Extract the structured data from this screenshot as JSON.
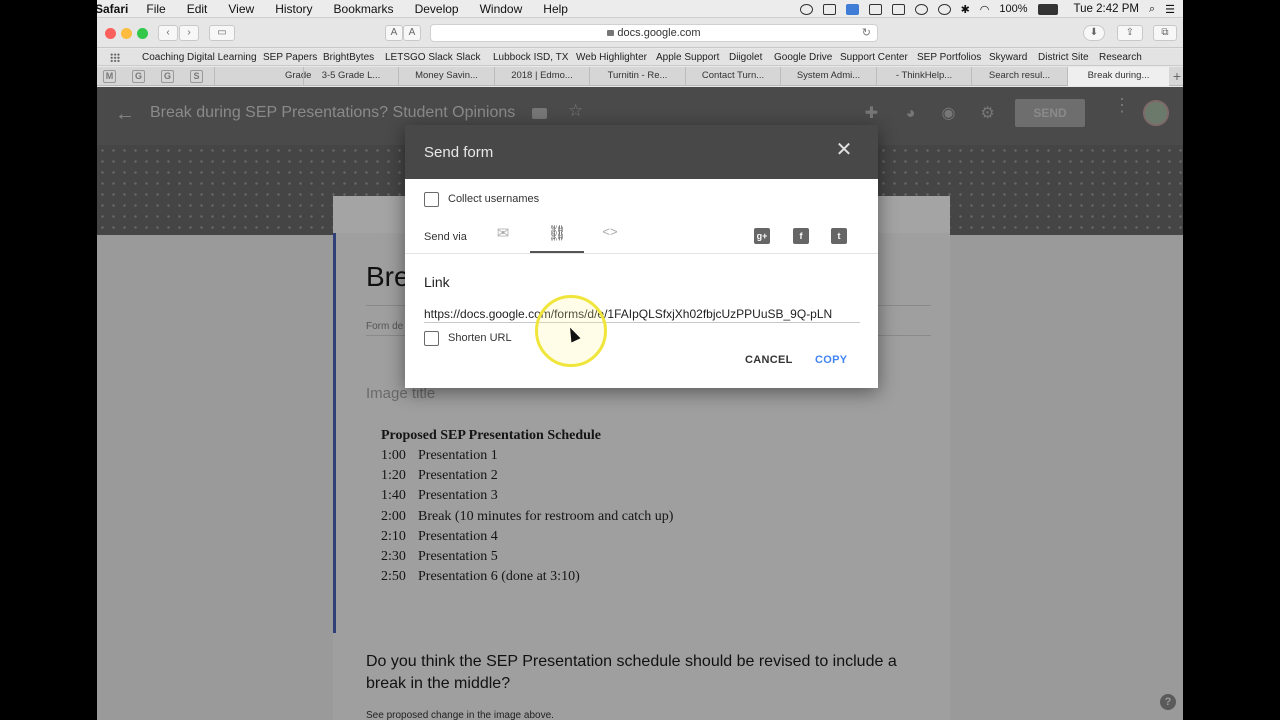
{
  "menubar": {
    "app": "Safari",
    "menus": [
      "File",
      "Edit",
      "View",
      "History",
      "Bookmarks",
      "Develop",
      "Window",
      "Help"
    ],
    "battery": "100%",
    "clock": "Tue 2:42 PM"
  },
  "browser": {
    "url": "docs.google.com",
    "bookmarks": [
      "Coaching Digital Learning",
      "SEP Papers",
      "BrightBytes",
      "LETSGO Slack",
      "Slack",
      "Lubbock ISD, TX",
      "Web Highlighter",
      "Apple Support",
      "Diigolet",
      "Google Drive",
      "Support Center",
      "SEP Portfolios",
      "Skyward",
      "District Site",
      "Research"
    ],
    "pinned_tabs": [
      "M",
      "G",
      "G",
      "S"
    ],
    "tabs": [
      "Grade",
      "3-5 Grade L...",
      "Money Savin...",
      "2018 | Edmo...",
      "Turnitin - Re...",
      "Contact Turn...",
      "System Admi...",
      "- ThinkHelp...",
      "Search resul...",
      "Break during..."
    ]
  },
  "forms": {
    "title": "Break during SEP Presentations? Student Opinions",
    "send_label": "SEND",
    "card_title": "Bre",
    "form_desc": "Form de",
    "image_title": "Image title",
    "schedule_heading": "Proposed SEP Presentation Schedule",
    "schedule": [
      {
        "time": "1:00",
        "label": "Presentation 1"
      },
      {
        "time": "1:20",
        "label": "Presentation 2"
      },
      {
        "time": "1:40",
        "label": "Presentation 3"
      },
      {
        "time": "2:00",
        "label": "Break (10 minutes for restroom and catch up)"
      },
      {
        "time": "2:10",
        "label": "Presentation 4"
      },
      {
        "time": "2:30",
        "label": "Presentation 5"
      },
      {
        "time": "2:50",
        "label": "Presentation 6 (done at 3:10)"
      }
    ],
    "question": "Do you think the SEP Presentation schedule should be revised to include a break in the middle?",
    "question_hint": "See proposed change in the image above."
  },
  "dialog": {
    "title": "Send form",
    "collect_usernames": "Collect usernames",
    "send_via": "Send via",
    "link_heading": "Link",
    "link_url": "https://docs.google.com/forms/d/e/1FAIpQLSfxjXh02fbjcUzPPUuSB_9Q-pLN",
    "shorten_url": "Shorten URL",
    "cancel": "CANCEL",
    "copy": "COPY",
    "accent_color": "#4285f4"
  },
  "icons": {
    "via_email": "email-icon",
    "via_link": "link-icon",
    "via_embed": "embed-icon",
    "social": [
      "google-plus-icon",
      "facebook-icon",
      "twitter-icon"
    ]
  }
}
